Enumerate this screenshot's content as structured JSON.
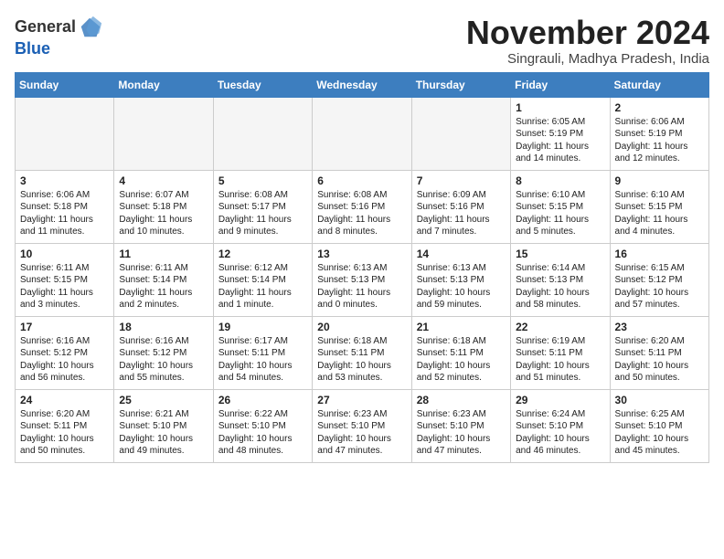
{
  "logo": {
    "line1": "General",
    "line2": "Blue"
  },
  "title": "November 2024",
  "subtitle": "Singrauli, Madhya Pradesh, India",
  "weekdays": [
    "Sunday",
    "Monday",
    "Tuesday",
    "Wednesday",
    "Thursday",
    "Friday",
    "Saturday"
  ],
  "weeks": [
    [
      {
        "day": "",
        "info": ""
      },
      {
        "day": "",
        "info": ""
      },
      {
        "day": "",
        "info": ""
      },
      {
        "day": "",
        "info": ""
      },
      {
        "day": "",
        "info": ""
      },
      {
        "day": "1",
        "info": "Sunrise: 6:05 AM\nSunset: 5:19 PM\nDaylight: 11 hours and 14 minutes."
      },
      {
        "day": "2",
        "info": "Sunrise: 6:06 AM\nSunset: 5:19 PM\nDaylight: 11 hours and 12 minutes."
      }
    ],
    [
      {
        "day": "3",
        "info": "Sunrise: 6:06 AM\nSunset: 5:18 PM\nDaylight: 11 hours and 11 minutes."
      },
      {
        "day": "4",
        "info": "Sunrise: 6:07 AM\nSunset: 5:18 PM\nDaylight: 11 hours and 10 minutes."
      },
      {
        "day": "5",
        "info": "Sunrise: 6:08 AM\nSunset: 5:17 PM\nDaylight: 11 hours and 9 minutes."
      },
      {
        "day": "6",
        "info": "Sunrise: 6:08 AM\nSunset: 5:16 PM\nDaylight: 11 hours and 8 minutes."
      },
      {
        "day": "7",
        "info": "Sunrise: 6:09 AM\nSunset: 5:16 PM\nDaylight: 11 hours and 7 minutes."
      },
      {
        "day": "8",
        "info": "Sunrise: 6:10 AM\nSunset: 5:15 PM\nDaylight: 11 hours and 5 minutes."
      },
      {
        "day": "9",
        "info": "Sunrise: 6:10 AM\nSunset: 5:15 PM\nDaylight: 11 hours and 4 minutes."
      }
    ],
    [
      {
        "day": "10",
        "info": "Sunrise: 6:11 AM\nSunset: 5:15 PM\nDaylight: 11 hours and 3 minutes."
      },
      {
        "day": "11",
        "info": "Sunrise: 6:11 AM\nSunset: 5:14 PM\nDaylight: 11 hours and 2 minutes."
      },
      {
        "day": "12",
        "info": "Sunrise: 6:12 AM\nSunset: 5:14 PM\nDaylight: 11 hours and 1 minute."
      },
      {
        "day": "13",
        "info": "Sunrise: 6:13 AM\nSunset: 5:13 PM\nDaylight: 11 hours and 0 minutes."
      },
      {
        "day": "14",
        "info": "Sunrise: 6:13 AM\nSunset: 5:13 PM\nDaylight: 10 hours and 59 minutes."
      },
      {
        "day": "15",
        "info": "Sunrise: 6:14 AM\nSunset: 5:13 PM\nDaylight: 10 hours and 58 minutes."
      },
      {
        "day": "16",
        "info": "Sunrise: 6:15 AM\nSunset: 5:12 PM\nDaylight: 10 hours and 57 minutes."
      }
    ],
    [
      {
        "day": "17",
        "info": "Sunrise: 6:16 AM\nSunset: 5:12 PM\nDaylight: 10 hours and 56 minutes."
      },
      {
        "day": "18",
        "info": "Sunrise: 6:16 AM\nSunset: 5:12 PM\nDaylight: 10 hours and 55 minutes."
      },
      {
        "day": "19",
        "info": "Sunrise: 6:17 AM\nSunset: 5:11 PM\nDaylight: 10 hours and 54 minutes."
      },
      {
        "day": "20",
        "info": "Sunrise: 6:18 AM\nSunset: 5:11 PM\nDaylight: 10 hours and 53 minutes."
      },
      {
        "day": "21",
        "info": "Sunrise: 6:18 AM\nSunset: 5:11 PM\nDaylight: 10 hours and 52 minutes."
      },
      {
        "day": "22",
        "info": "Sunrise: 6:19 AM\nSunset: 5:11 PM\nDaylight: 10 hours and 51 minutes."
      },
      {
        "day": "23",
        "info": "Sunrise: 6:20 AM\nSunset: 5:11 PM\nDaylight: 10 hours and 50 minutes."
      }
    ],
    [
      {
        "day": "24",
        "info": "Sunrise: 6:20 AM\nSunset: 5:11 PM\nDaylight: 10 hours and 50 minutes."
      },
      {
        "day": "25",
        "info": "Sunrise: 6:21 AM\nSunset: 5:10 PM\nDaylight: 10 hours and 49 minutes."
      },
      {
        "day": "26",
        "info": "Sunrise: 6:22 AM\nSunset: 5:10 PM\nDaylight: 10 hours and 48 minutes."
      },
      {
        "day": "27",
        "info": "Sunrise: 6:23 AM\nSunset: 5:10 PM\nDaylight: 10 hours and 47 minutes."
      },
      {
        "day": "28",
        "info": "Sunrise: 6:23 AM\nSunset: 5:10 PM\nDaylight: 10 hours and 47 minutes."
      },
      {
        "day": "29",
        "info": "Sunrise: 6:24 AM\nSunset: 5:10 PM\nDaylight: 10 hours and 46 minutes."
      },
      {
        "day": "30",
        "info": "Sunrise: 6:25 AM\nSunset: 5:10 PM\nDaylight: 10 hours and 45 minutes."
      }
    ]
  ]
}
